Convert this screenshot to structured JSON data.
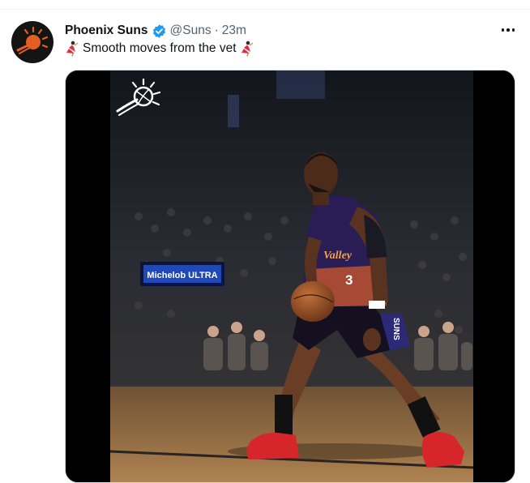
{
  "tweet": {
    "author_name": "Phoenix Suns",
    "handle": "@Suns",
    "separator": "·",
    "time": "23m",
    "text": "Smooth moves from the vet",
    "leading_emoji": "dancer",
    "trailing_emoji": "dancer"
  },
  "media": {
    "arena_sign_text": "Michelob ULTRA",
    "jersey_text": "Valley",
    "jersey_number": "3",
    "shorts_text": "SUNS"
  },
  "colors": {
    "verified": "#1d9bf0",
    "muted": "#536471",
    "text": "#0f1419",
    "jersey": "#2a1d55",
    "shoes": "#d6262c"
  }
}
